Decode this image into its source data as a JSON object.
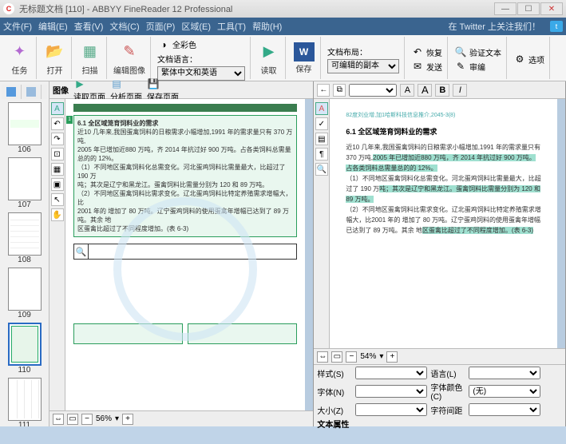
{
  "title": "无标题文档 [110] - ABBYY FineReader 12 Professional",
  "menus": [
    "文件(F)",
    "编辑(E)",
    "查看(V)",
    "文档(C)",
    "页面(P)",
    "区域(E)",
    "工具(T)",
    "帮助(H)"
  ],
  "twitter_text": "在 Twitter 上关注我们！",
  "ribbon": {
    "task": "任务",
    "open": "打开",
    "scan": "扫描",
    "edit_image": "编辑图像",
    "color_mode": "全彩色",
    "doc_lang_label": "文档语言：",
    "doc_lang": "繁体中文和英语",
    "read": "读取",
    "save": "保存",
    "layout_label": "文档布局：",
    "layout": "可编辑的副本",
    "restore": "恢复",
    "send": "发送",
    "verify": "验证文本",
    "edit": "审编",
    "options": "选项"
  },
  "tabs": {
    "image": "图像",
    "read_page": "读取页面",
    "analyze_page": "分析页面",
    "save_page": "保存页面"
  },
  "thumbs": [
    106,
    107,
    108,
    109,
    110,
    111
  ],
  "selected_thumb": 110,
  "image_zoom": "56%",
  "text_zoom": "54%",
  "doc": {
    "header": "82度刘业增,加1哈斯科技信息推介,2045-3(8)",
    "section_title": "6.1  全区域笼育饲料业的需求",
    "body1": "近10 几年来,我国蛋禽饲料的日粮需求小幅增加,1991 年的需求量只有 370 万吨,",
    "body2": "2005 年已增加近880 万吨，齐 2014 年抗过好 900 万吨。占各类饲料总需量总的的 12%。",
    "body3": "（1）不同地区蛋禽饲料化总需变化。河北蛋鸡饲料比需量最大，比超过了 190 万",
    "body4": "吨；其次是辽宁和黑龙江。蛋禽饲料比需量分别为 120 和 89 万吨。",
    "body5": "（2）不同地区蛋禽饲料比需求变化。辽北蛋鸡饲料比特定养殖需求增幅大，比",
    "body6": "2001 年的 增加了 80 万吨。辽宁蛋鸡饲料的使用蛋禽年增幅已达到了 89 万吨。其余 地",
    "body7": "区蛋禽比超过了不同程度增加。(表 6-3)"
  },
  "props": {
    "style": "样式(S)",
    "lang": "语言(L)",
    "font": "字体(N)",
    "font_color": "字体颜色(C)",
    "size": "大小(Z)",
    "char_spacing": "字符间距",
    "text_props": "文本属性",
    "none": "(无)"
  },
  "fmt": {
    "A": "A",
    "B": "B",
    "I": "I"
  }
}
